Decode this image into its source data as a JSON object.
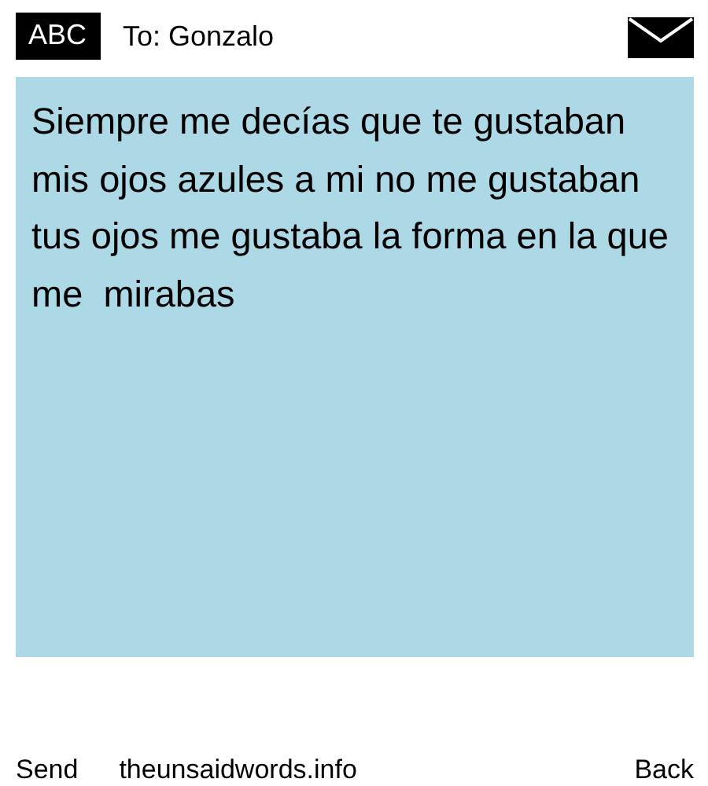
{
  "header": {
    "badge": "ABC",
    "recipient": "To: Gonzalo"
  },
  "message": {
    "text": "Siempre me decías que te gustaban mis ojos azules a mi no me gustaban tus ojos me gustaba la forma en la que me  mirabas"
  },
  "footer": {
    "left": "Send",
    "site": "theunsaidwords.info",
    "right": "Back"
  }
}
